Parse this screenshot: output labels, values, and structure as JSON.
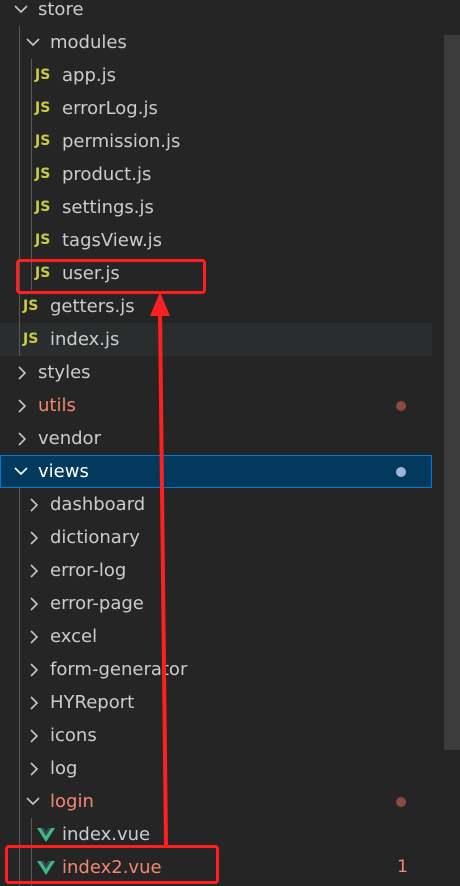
{
  "explorer": {
    "items": [
      {
        "label": "store",
        "kind": "folder",
        "open": true,
        "depth": 0
      },
      {
        "label": "modules",
        "kind": "folder",
        "open": true,
        "depth": 1
      },
      {
        "label": "app.js",
        "kind": "js",
        "depth": 2
      },
      {
        "label": "errorLog.js",
        "kind": "js",
        "depth": 2
      },
      {
        "label": "permission.js",
        "kind": "js",
        "depth": 2
      },
      {
        "label": "product.js",
        "kind": "js",
        "depth": 2
      },
      {
        "label": "settings.js",
        "kind": "js",
        "depth": 2
      },
      {
        "label": "tagsView.js",
        "kind": "js",
        "depth": 2
      },
      {
        "label": "user.js",
        "kind": "js",
        "depth": 2
      },
      {
        "label": "getters.js",
        "kind": "js",
        "depth": 1
      },
      {
        "label": "index.js",
        "kind": "js",
        "depth": 1
      },
      {
        "label": "styles",
        "kind": "folder",
        "open": false,
        "depth": 0
      },
      {
        "label": "utils",
        "kind": "folder",
        "open": false,
        "depth": 0,
        "error": true
      },
      {
        "label": "vendor",
        "kind": "folder",
        "open": false,
        "depth": 0
      },
      {
        "label": "views",
        "kind": "folder",
        "open": true,
        "depth": 0
      },
      {
        "label": "dashboard",
        "kind": "folder",
        "open": false,
        "depth": 1
      },
      {
        "label": "dictionary",
        "kind": "folder",
        "open": false,
        "depth": 1
      },
      {
        "label": "error-log",
        "kind": "folder",
        "open": false,
        "depth": 1
      },
      {
        "label": "error-page",
        "kind": "folder",
        "open": false,
        "depth": 1
      },
      {
        "label": "excel",
        "kind": "folder",
        "open": false,
        "depth": 1
      },
      {
        "label": "form-generator",
        "kind": "folder",
        "open": false,
        "depth": 1
      },
      {
        "label": "HYReport",
        "kind": "folder",
        "open": false,
        "depth": 1
      },
      {
        "label": "icons",
        "kind": "folder",
        "open": false,
        "depth": 1
      },
      {
        "label": "log",
        "kind": "folder",
        "open": false,
        "depth": 1
      },
      {
        "label": "login",
        "kind": "folder",
        "open": true,
        "depth": 1,
        "error": true
      },
      {
        "label": "index.vue",
        "kind": "vue",
        "depth": 2
      },
      {
        "label": "index2.vue",
        "kind": "vue",
        "depth": 2,
        "error": true
      }
    ],
    "js_badge": "JS",
    "error_count": "1"
  },
  "colors": {
    "error": "#f48771",
    "js_icon": "#cbcb41",
    "vue_icon": "#41b883",
    "selection": "#04395e",
    "annotation": "#ff1f1f"
  }
}
